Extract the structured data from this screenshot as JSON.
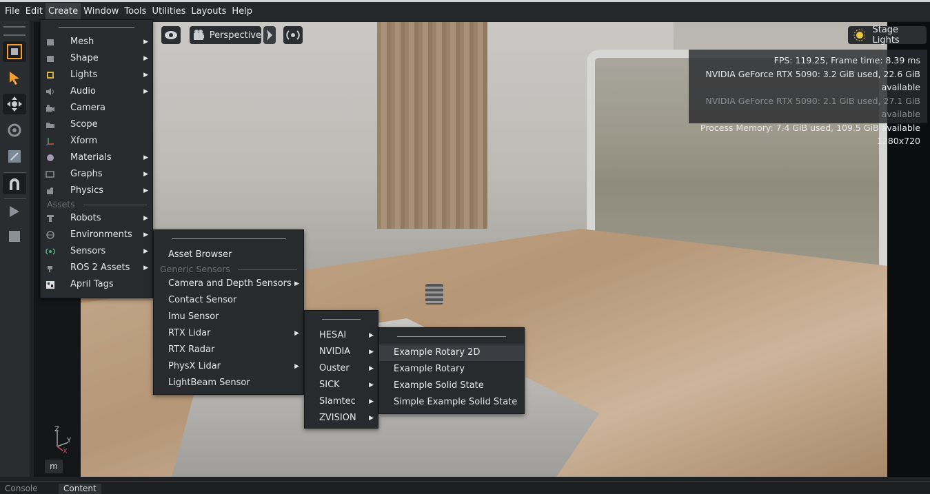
{
  "menubar": {
    "items": [
      "File",
      "Edit",
      "Create",
      "Window",
      "Tools",
      "Utilities",
      "Layouts",
      "Help"
    ],
    "active_index": 2
  },
  "viewport": {
    "camera_label": "Perspective",
    "stage_lights_label": "Stage Lights",
    "stats": {
      "fps": "FPS: 119.25, Frame time: 8.39 ms",
      "gpu1": "NVIDIA GeForce RTX 5090: 3.2 GiB used, 22.6 GiB available",
      "gpu2": "NVIDIA GeForce RTX 5090: 2.1 GiB used, 27.1 GiB available",
      "process_memory": "Process Memory: 7.4 GiB used, 109.5 GiB available",
      "resolution": "1280x720"
    },
    "axis": {
      "z": "Z",
      "y": "Y",
      "x": "X"
    },
    "m_button": "m"
  },
  "create_menu": {
    "items": [
      {
        "label": "Mesh",
        "icon": "mesh-icon",
        "submenu": true
      },
      {
        "label": "Shape",
        "icon": "shape-icon",
        "submenu": true
      },
      {
        "label": "Lights",
        "icon": "lights-icon",
        "submenu": true
      },
      {
        "label": "Audio",
        "icon": "audio-icon",
        "submenu": true
      },
      {
        "label": "Camera",
        "icon": "camera-icon",
        "submenu": false
      },
      {
        "label": "Scope",
        "icon": "folder-icon",
        "submenu": false
      },
      {
        "label": "Xform",
        "icon": "xform-icon",
        "submenu": false
      },
      {
        "label": "Materials",
        "icon": "materials-icon",
        "submenu": true
      },
      {
        "label": "Graphs",
        "icon": "graphs-icon",
        "submenu": true
      },
      {
        "label": "Physics",
        "icon": "physics-icon",
        "submenu": true
      }
    ],
    "section_assets": "Assets",
    "asset_items": [
      {
        "label": "Robots",
        "icon": "robot-icon",
        "submenu": true
      },
      {
        "label": "Environments",
        "icon": "globe-icon",
        "submenu": true
      },
      {
        "label": "Sensors",
        "icon": "sensor-icon",
        "submenu": true
      },
      {
        "label": "ROS 2 Assets",
        "icon": "plug-icon",
        "submenu": true
      },
      {
        "label": "April Tags",
        "icon": "apriltag-icon",
        "submenu": false
      }
    ]
  },
  "sensors_menu": {
    "asset_browser": "Asset Browser",
    "section": "Generic Sensors",
    "items": [
      {
        "label": "Camera and Depth Sensors",
        "submenu": true
      },
      {
        "label": "Contact Sensor",
        "submenu": false
      },
      {
        "label": "Imu Sensor",
        "submenu": false
      },
      {
        "label": "RTX Lidar",
        "submenu": true
      },
      {
        "label": "RTX Radar",
        "submenu": false
      },
      {
        "label": "PhysX Lidar",
        "submenu": true
      },
      {
        "label": "LightBeam Sensor",
        "submenu": false
      }
    ]
  },
  "lidar_menu": {
    "items": [
      {
        "label": "HESAI",
        "submenu": true
      },
      {
        "label": "NVIDIA",
        "submenu": true
      },
      {
        "label": "Ouster",
        "submenu": true
      },
      {
        "label": "SICK",
        "submenu": true
      },
      {
        "label": "Slamtec",
        "submenu": true
      },
      {
        "label": "ZVISION",
        "submenu": true
      }
    ]
  },
  "nvidia_menu": {
    "items": [
      "Example Rotary 2D",
      "Example Rotary",
      "Example Solid State",
      "Simple Example Solid State"
    ],
    "highlighted_index": 0
  },
  "bottom_tabs": [
    "Console",
    "Content"
  ],
  "colors": {
    "accent_orange": "#f0a030",
    "menu_bg": "#282b2e",
    "highlight": "#3a3e42"
  }
}
